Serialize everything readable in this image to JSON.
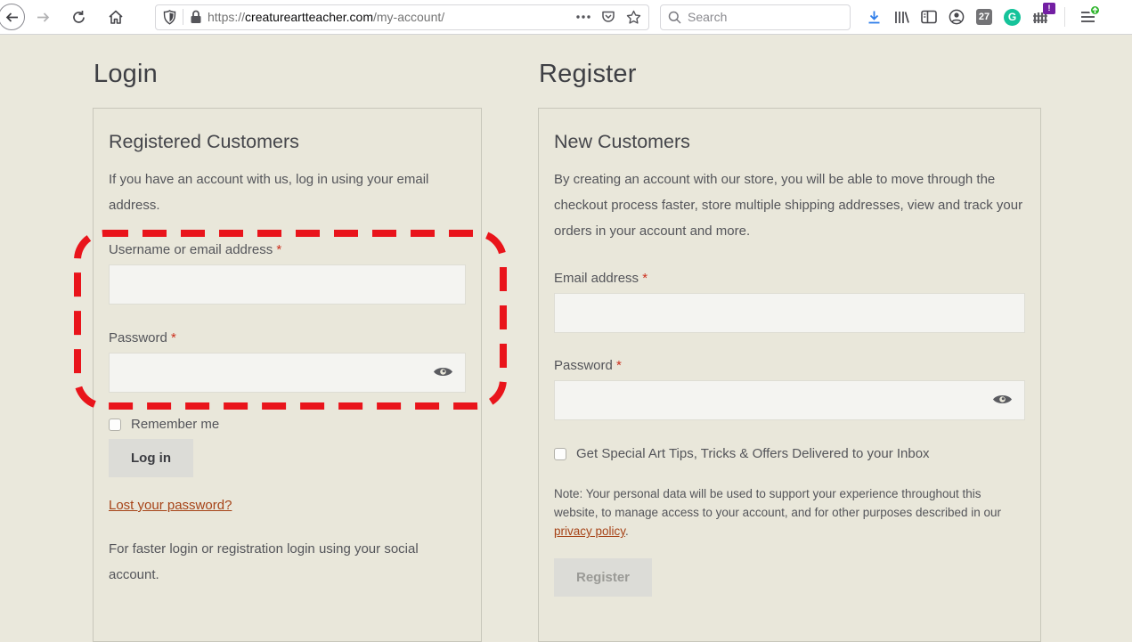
{
  "browser": {
    "url": {
      "scheme": "https://",
      "domain": "creatureartteacher.com",
      "path": "/my-account/"
    },
    "search": {
      "placeholder": "Search"
    },
    "extension_badge": "27",
    "grammarly_letter": "G",
    "alert_badge": "!",
    "icons": {
      "back": "left-arrow-in-circle",
      "forward": "right-arrow",
      "refresh": "circular-arrow",
      "home": "house",
      "shield": "tracking-protection-shield",
      "lock": "padlock",
      "more": "ellipsis",
      "pocket": "pocket-chevron",
      "bookmark": "star-outline",
      "search": "magnifier",
      "download": "blue-down-arrow",
      "library": "book-stack",
      "sidebar": "split-panel",
      "account": "person-circle",
      "fence": "fence-bars",
      "menu": "hamburger",
      "eye": "password-reveal-eye",
      "update": "green-up-arrow"
    }
  },
  "login": {
    "title": "Login",
    "card_title": "Registered Customers",
    "intro": "If you have an account with us, log in using your email address.",
    "username_label": "Username or email address",
    "password_label": "Password",
    "required_marker": "*",
    "remember_label": "Remember me",
    "login_button": "Log in",
    "lost_password_link": "Lost your password?",
    "social_text": "For faster login or registration login using your social account."
  },
  "register": {
    "title": "Register",
    "card_title": "New Customers",
    "intro": "By creating an account with our store, you will be able to move through the checkout process faster, store multiple shipping addresses, view and track your orders in your account and more.",
    "email_label": "Email address",
    "password_label": "Password",
    "required_marker": "*",
    "newsletter_label": "Get Special Art Tips, Tricks & Offers Delivered to your Inbox",
    "note_prefix": "Note: Your personal data will be used to support your experience throughout this website, to manage access to your account, and for other purposes described in our ",
    "privacy_link": "privacy policy",
    "note_suffix": ".",
    "register_button": "Register"
  },
  "colors": {
    "annotation_red": "#e9141b",
    "link_rust": "#a64317",
    "download_blue": "#2e7de9",
    "grammarly_green": "#15c39a",
    "badge_purple": "#731fa3",
    "update_green": "#2fb52c",
    "page_background": "#eae8dc",
    "input_background": "#f4f4f1"
  }
}
